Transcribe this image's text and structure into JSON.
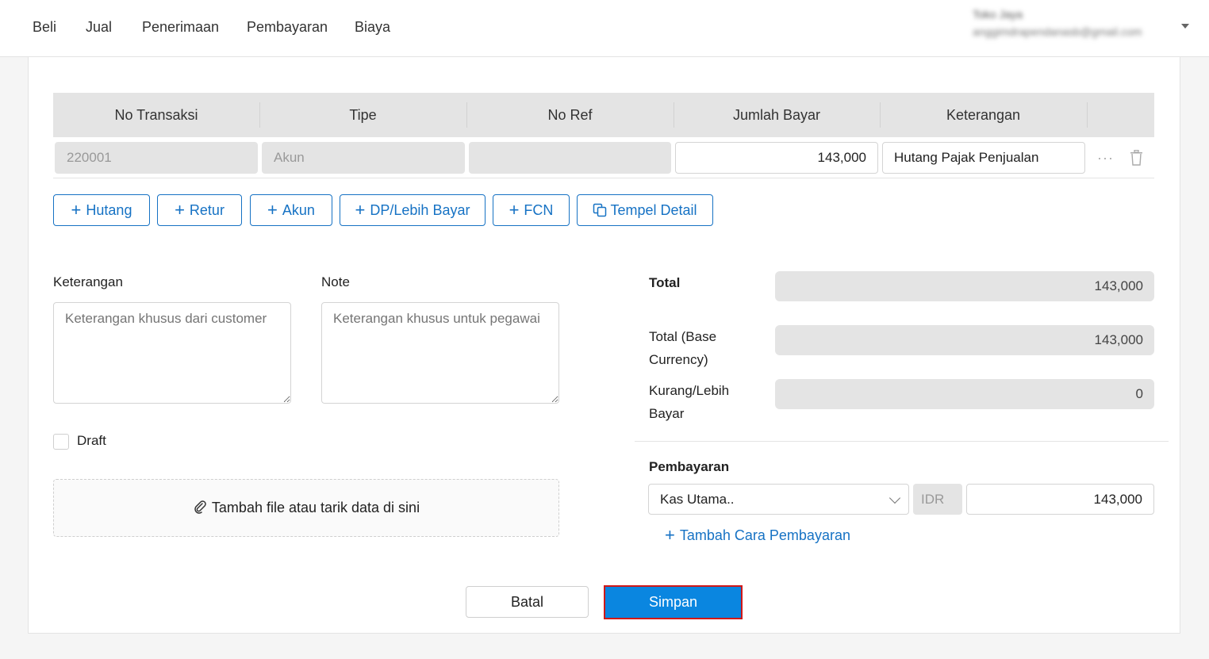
{
  "nav": {
    "items": [
      "Beli",
      "Jual",
      "Penerimaan",
      "Pembayaran",
      "Biaya"
    ]
  },
  "user": {
    "name": "Toko Jaya",
    "email": "anggimdrapendanasb@gmail.com"
  },
  "table": {
    "headers": [
      "No Transaksi",
      "Tipe",
      "No Ref",
      "Jumlah Bayar",
      "Keterangan"
    ],
    "rows": [
      {
        "no_transaksi": "220001",
        "tipe": "Akun",
        "no_ref": "",
        "jumlah_bayar": "143,000",
        "keterangan": "Hutang Pajak Penjualan"
      }
    ],
    "row_actions": {
      "more": "···"
    }
  },
  "add_buttons": {
    "hutang": "Hutang",
    "retur": "Retur",
    "akun": "Akun",
    "dp": "DP/Lebih Bayar",
    "fcn": "FCN",
    "tempel": "Tempel Detail"
  },
  "form": {
    "keterangan_label": "Keterangan",
    "keterangan_placeholder": "Keterangan khusus dari customer",
    "note_label": "Note",
    "note_placeholder": "Keterangan khusus untuk pegawai",
    "draft_label": "Draft",
    "draft_checked": false,
    "dropzone_label": "Tambah file atau tarik data di sini"
  },
  "summary": {
    "total_label": "Total",
    "total_value": "143,000",
    "base_label_1": "Total (Base",
    "base_label_2": "Currency)",
    "base_value": "143,000",
    "kurang_label_1": "Kurang/Lebih",
    "kurang_label_2": "Bayar",
    "kurang_value": "0"
  },
  "payment": {
    "title": "Pembayaran",
    "method": "Kas Utama..",
    "currency": "IDR",
    "amount": "143,000",
    "add_label": "Tambah Cara Pembayaran"
  },
  "actions": {
    "cancel": "Batal",
    "save": "Simpan"
  },
  "colors": {
    "accent": "#1672c4",
    "save_button": "#0a86e0",
    "highlight_border": "#d01818"
  }
}
